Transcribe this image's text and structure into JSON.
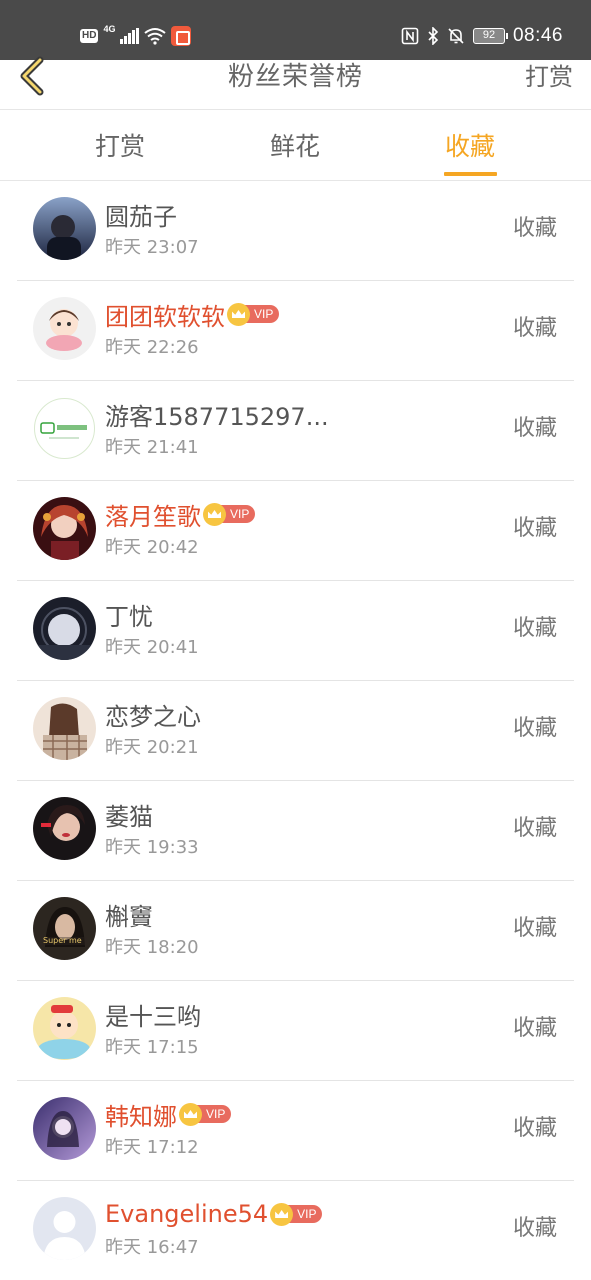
{
  "status_bar": {
    "hd": "HD",
    "network": "4G",
    "battery": "92",
    "time": "08:46"
  },
  "header": {
    "title": "粉丝荣誉榜",
    "action": "打赏"
  },
  "tabs": [
    {
      "label": "打赏",
      "active": false
    },
    {
      "label": "鲜花",
      "active": false
    },
    {
      "label": "收藏",
      "active": true
    }
  ],
  "list": [
    {
      "name": "圆茄子",
      "time": "昨天 23:07",
      "vip": false,
      "action": "收藏",
      "avatar": "avatar-dark-boy"
    },
    {
      "name": "团团软软软",
      "time": "昨天 22:26",
      "vip": true,
      "vip_label": "VIP",
      "action": "收藏",
      "avatar": "avatar-cartoon-girl"
    },
    {
      "name": "游客1587715297...",
      "time": "昨天 21:41",
      "vip": false,
      "action": "收藏",
      "avatar": "avatar-iqiyi-logo"
    },
    {
      "name": "落月笙歌",
      "time": "昨天 20:42",
      "vip": true,
      "vip_label": "VIP",
      "action": "收藏",
      "avatar": "avatar-anime-girl"
    },
    {
      "name": "丁忧",
      "time": "昨天 20:41",
      "vip": false,
      "action": "收藏",
      "avatar": "avatar-moon"
    },
    {
      "name": "恋梦之心",
      "time": "昨天 20:21",
      "vip": false,
      "action": "收藏",
      "avatar": "avatar-plaid-girl"
    },
    {
      "name": "萎猫",
      "time": "昨天 19:33",
      "vip": false,
      "action": "收藏",
      "avatar": "avatar-red-girl"
    },
    {
      "name": "槲竇",
      "time": "昨天 18:20",
      "vip": false,
      "action": "收藏",
      "avatar": "avatar-super-me"
    },
    {
      "name": "是十三哟",
      "time": "昨天 17:15",
      "vip": false,
      "action": "收藏",
      "avatar": "avatar-crayon-shin"
    },
    {
      "name": "韩知娜",
      "time": "昨天 17:12",
      "vip": true,
      "vip_label": "VIP",
      "action": "收藏",
      "avatar": "avatar-purple-girl"
    },
    {
      "name": "Evangeline54",
      "time": "昨天 16:47",
      "vip": true,
      "vip_label": "VIP",
      "action": "收藏",
      "avatar": "avatar-default-person"
    }
  ],
  "colors": {
    "accent": "#f5a623",
    "vip_name": "#e0502f",
    "vip_badge": "#e86b5e",
    "status_bar_bg": "#4a4a4a"
  }
}
